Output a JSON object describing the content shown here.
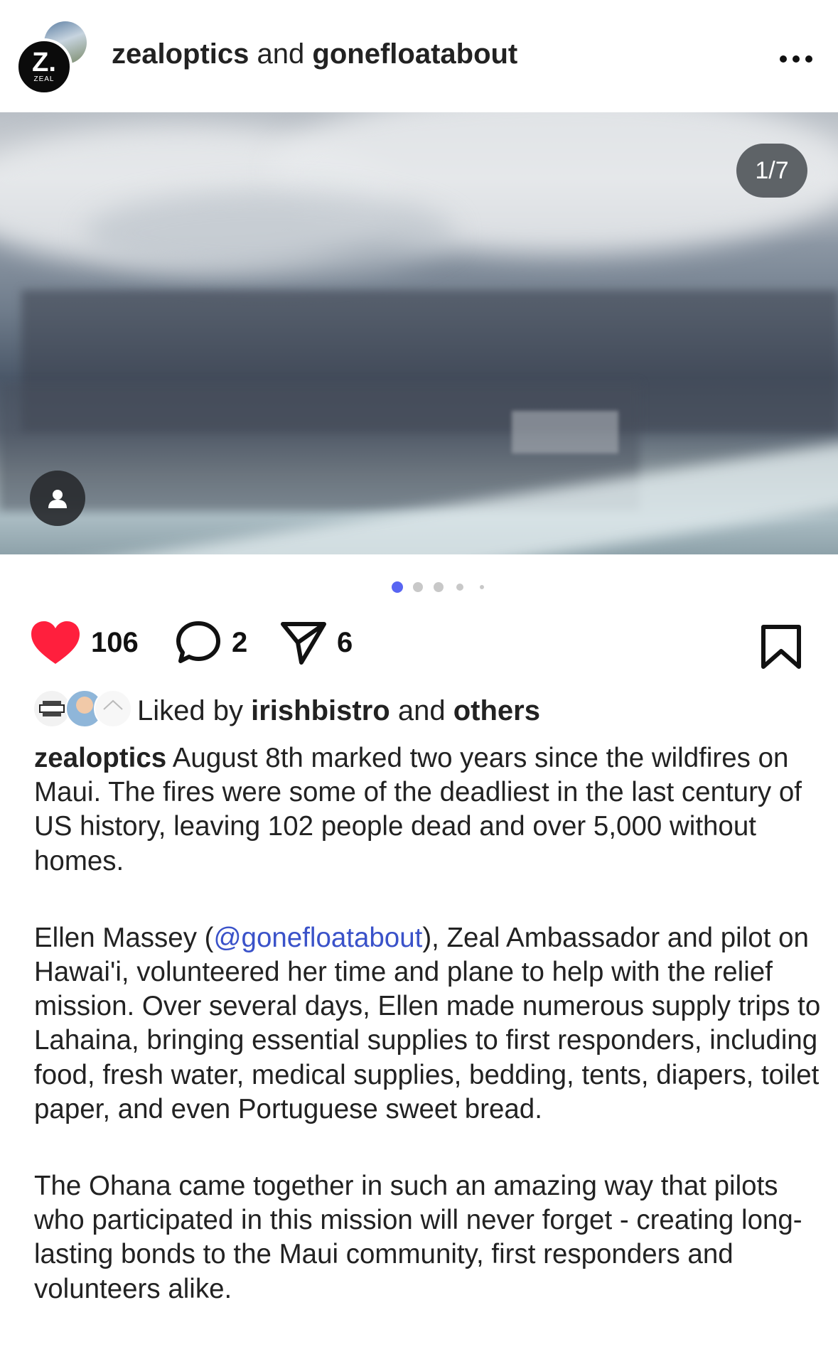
{
  "header": {
    "account_a": "zealoptics",
    "conjunction": "and",
    "account_b": "gonefloatabout",
    "avatar_logo_letter": "Z.",
    "avatar_logo_text": "ZEAL",
    "more_icon": "more-horizontal-icon"
  },
  "photo": {
    "counter": "1/7",
    "tag_icon": "user-tag-icon"
  },
  "carousel": {
    "active_index": 0,
    "dot_count": 5,
    "active_color": "#5865f2"
  },
  "actions": {
    "likes_count": "106",
    "comments_count": "2",
    "shares_count": "6",
    "like_color": "#ff1f3d"
  },
  "liked_by": {
    "prefix": "Liked by",
    "user": "irishbistro",
    "conjunction": "and",
    "others": "others"
  },
  "caption": {
    "username": "zealoptics",
    "para1": " August 8th marked two years since the wildfires on Maui. The fires were some of the deadliest in the last century of US history, leaving 102 people dead and over 5,000 without homes.",
    "para2_start": "Ellen Massey (",
    "para2_mention": "@gonefloatabout",
    "para2_end": "), Zeal Ambassador and pilot on Hawai'i, volunteered her time and plane to help with the relief mission. Over several days, Ellen made numerous supply trips to Lahaina, bringing essential supplies to first responders, including food, fresh water, medical supplies, bedding, tents, diapers, toilet paper, and even Portuguese sweet bread.",
    "para3": "The Ohana came together in such an amazing way that pilots who participated in this mission will never forget - creating long-lasting bonds to the Maui community, first responders and volunteers alike."
  }
}
